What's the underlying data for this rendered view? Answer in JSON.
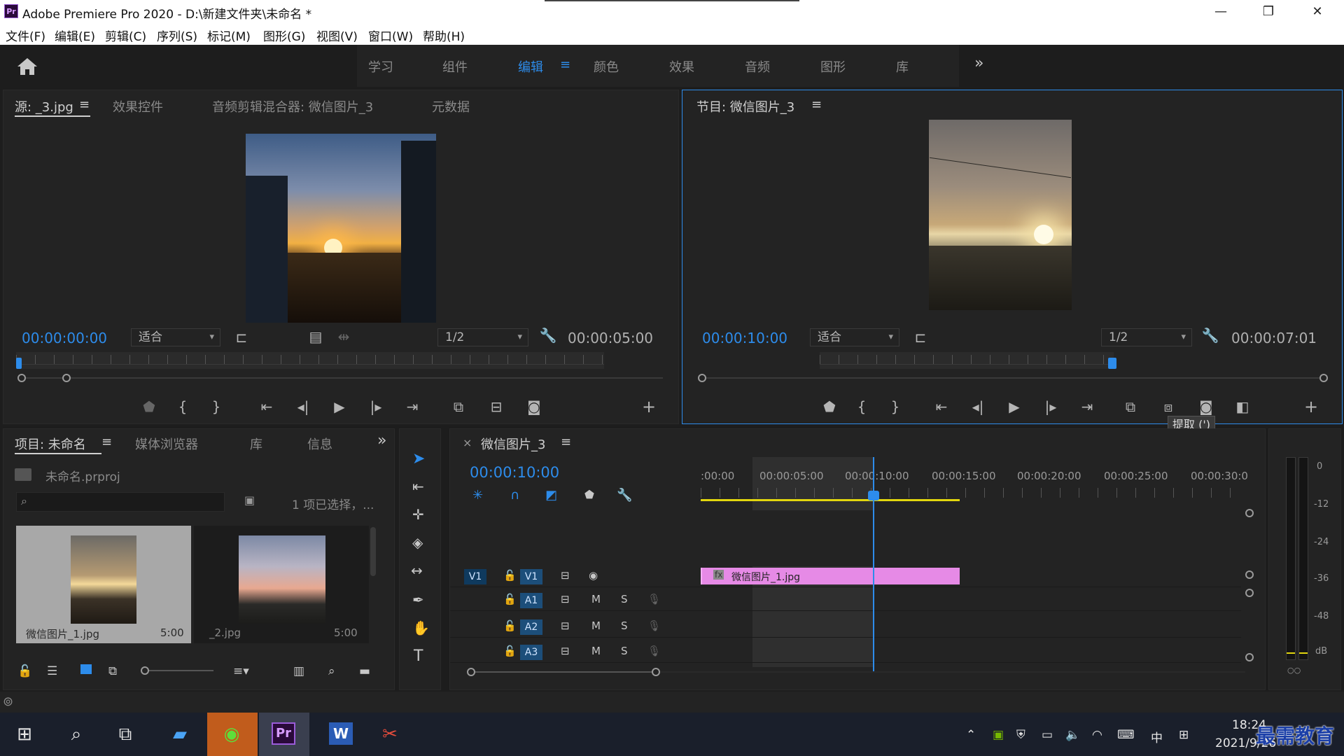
{
  "window": {
    "app_icon": "Pr",
    "title": "Adobe Premiere Pro 2020 - D:\\新建文件夹\\未命名 *",
    "buttons": {
      "minimize": "—",
      "restore": "❐",
      "close": "✕"
    }
  },
  "menu": [
    "文件(F)",
    "编辑(E)",
    "剪辑(C)",
    "序列(S)",
    "标记(M)",
    "图形(G)",
    "视图(V)",
    "窗口(W)",
    "帮助(H)"
  ],
  "workspace": {
    "tabs": [
      "学习",
      "组件",
      "编辑",
      "颜色",
      "效果",
      "音频",
      "图形",
      "库"
    ],
    "active_tab": "编辑",
    "more": "»"
  },
  "source_monitor": {
    "tabs": [
      "源: _3.jpg",
      "效果控件",
      "音频剪辑混合器: 微信图片_3",
      "元数据"
    ],
    "timecode_in": "00:00:00:00",
    "fit": "适合",
    "resolution": "1/2",
    "duration": "00:00:05:00"
  },
  "program_monitor": {
    "title": "节目: 微信图片_3",
    "timecode": "00:00:10:00",
    "fit": "适合",
    "resolution": "1/2",
    "duration": "00:00:07:01",
    "tooltip": "提取 (')"
  },
  "project": {
    "tabs": [
      "项目: 未命名",
      "媒体浏览器",
      "库",
      "信息"
    ],
    "file": "未命名.prproj",
    "search_placeholder": "",
    "selection": "1 项已选择，...",
    "items": [
      {
        "name": "微信图片_1.jpg",
        "duration": "5:00"
      },
      {
        "name": "_2.jpg",
        "duration": "5:00"
      }
    ]
  },
  "timeline": {
    "title": "微信图片_3",
    "timecode": "00:00:10:00",
    "ruler": [
      ":00:00",
      "00:00:05:00",
      "00:00:10:00",
      "00:00:15:00",
      "00:00:20:00",
      "00:00:25:00",
      "00:00:30:0"
    ],
    "tracks": [
      {
        "src": "V1",
        "name": "V1",
        "type": "video"
      },
      {
        "src": "",
        "name": "A1",
        "type": "audio"
      },
      {
        "src": "",
        "name": "A2",
        "type": "audio"
      },
      {
        "src": "",
        "name": "A3",
        "type": "audio"
      }
    ],
    "clip": {
      "name": "微信图片_1.jpg",
      "fx": "fx"
    },
    "m_label": "M",
    "s_label": "S"
  },
  "meter": {
    "labels": [
      "0",
      "-12",
      "-24",
      "-36",
      "-48",
      "dB"
    ]
  },
  "taskbar": {
    "clock_time": "18:24",
    "clock_date": "2021/9/26",
    "ime": "中",
    "watermark": "最需教育"
  },
  "colors": {
    "accent": "#2d8ceb",
    "clip": "#e68ae6",
    "playhead": "#2d8ceb",
    "inout": "#e2d60e"
  }
}
